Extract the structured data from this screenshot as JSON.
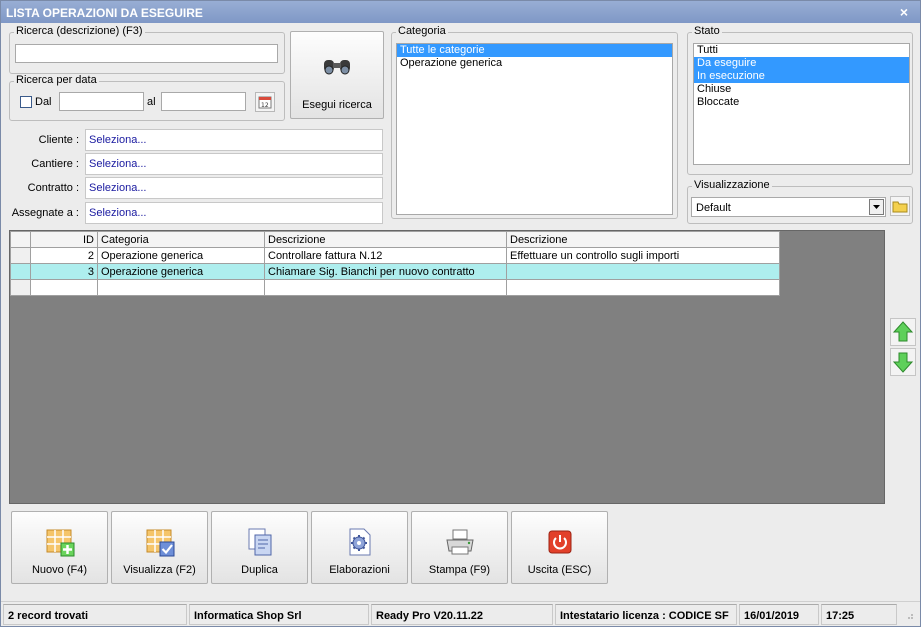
{
  "window": {
    "title": "LISTA OPERAZIONI DA ESEGUIRE",
    "close_glyph": "×"
  },
  "search": {
    "group_label": "Ricerca (descrizione) (F3)",
    "value": ""
  },
  "date_search": {
    "group_label": "Ricerca per data",
    "from_label": "Dal",
    "from_checked": false,
    "to_label": "al",
    "from_value": "",
    "to_value": ""
  },
  "search_button": {
    "label": "Esegui ricerca"
  },
  "filters": [
    {
      "label": "Cliente :",
      "value": "Seleziona..."
    },
    {
      "label": "Cantiere :",
      "value": "Seleziona..."
    },
    {
      "label": "Contratto :",
      "value": "Seleziona..."
    },
    {
      "label": "Assegnate a :",
      "value": "Seleziona..."
    }
  ],
  "category": {
    "group_label": "Categoria",
    "items": [
      {
        "label": "Tutte le categorie",
        "selected": true
      },
      {
        "label": "Operazione generica",
        "selected": false
      }
    ]
  },
  "state": {
    "group_label": "Stato",
    "items": [
      {
        "label": "Tutti",
        "selected": false
      },
      {
        "label": "Da eseguire",
        "selected": true
      },
      {
        "label": "In esecuzione",
        "selected": true
      },
      {
        "label": "Chiuse",
        "selected": false
      },
      {
        "label": "Bloccate",
        "selected": false
      }
    ]
  },
  "view": {
    "group_label": "Visualizzazione",
    "selected": "Default"
  },
  "grid": {
    "columns": [
      "ID",
      "Categoria",
      "Descrizione",
      "Descrizione"
    ],
    "rows": [
      {
        "id": "2",
        "category": "Operazione generica",
        "description": "Controllare fattura N.12",
        "description2": "Effettuare un controllo sugli importi",
        "highlight": false
      },
      {
        "id": "3",
        "category": "Operazione generica",
        "description": "Chiamare Sig. Bianchi per nuovo contratto",
        "description2": "",
        "highlight": true
      }
    ]
  },
  "toolbar": {
    "new_label": "Nuovo (F4)",
    "view_label": "Visualizza (F2)",
    "duplicate_label": "Duplica",
    "process_label": "Elaborazioni",
    "print_label": "Stampa (F9)",
    "exit_label": "Uscita (ESC)"
  },
  "status": {
    "records": "2 record trovati",
    "company": "Informatica Shop Srl",
    "version": "Ready Pro V20.11.22",
    "license": "Intestatario licenza : CODICE SF",
    "date": "16/01/2019",
    "time": "17:25"
  },
  "colors": {
    "title_bar": "#8aa2ce",
    "selection": "#3399ff",
    "row_highlight": "#aeeeee",
    "grid_background": "#808080",
    "lookup_text": "#1a1aa0"
  }
}
